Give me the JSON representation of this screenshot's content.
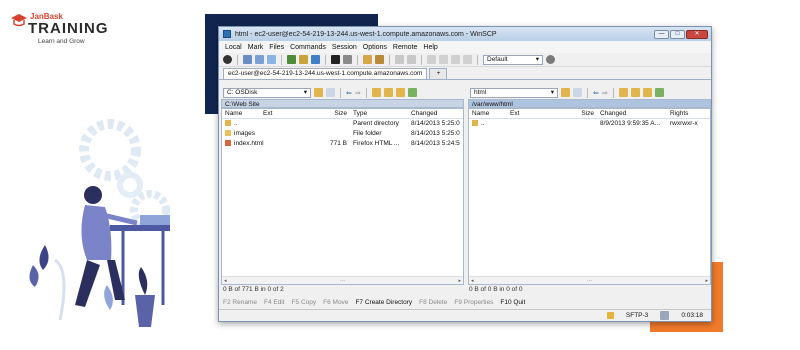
{
  "brand": {
    "name_small": "JanBask",
    "name_big": "TRAINING",
    "tagline": "Learn and Grow"
  },
  "window": {
    "title": "html - ec2-user@ec2-54-219-13-244.us-west-1.compute.amazonaws.com - WinSCP",
    "buttons": [
      "—",
      "□",
      "✕"
    ]
  },
  "menu": [
    "Local",
    "Mark",
    "Files",
    "Commands",
    "Session",
    "Options",
    "Remote",
    "Help"
  ],
  "toolbar": {
    "transfer_setting": "Default"
  },
  "tabs": [
    {
      "label": "ec2-user@ec2-54-219-13-244.us-west-1.compute.amazonaws.com"
    },
    {
      "label": "+"
    }
  ],
  "left_pane": {
    "drive": "C: OSDisk",
    "path": "C:\\Web Site",
    "columns": [
      "Name",
      "Ext",
      "Size",
      "Type",
      "Changed"
    ],
    "rows": [
      {
        "name": "..",
        "ext": "",
        "size": "",
        "type": "Parent directory",
        "changed": "8/14/2013 5:25:0",
        "icon": "parent-folder-icon"
      },
      {
        "name": "images",
        "ext": "",
        "size": "",
        "type": "File folder",
        "changed": "8/14/2013 5:25:0",
        "icon": "folder-icon"
      },
      {
        "name": "index.html",
        "ext": "",
        "size": "771 B",
        "type": "Firefox HTML ...",
        "changed": "8/14/2013 5:24:5",
        "icon": "html-file-icon"
      }
    ],
    "status": "0 B of 771 B in 0 of 2"
  },
  "right_pane": {
    "drive": "html",
    "path": "/var/www/html",
    "columns": [
      "Name",
      "Ext",
      "Size",
      "Changed",
      "Rights"
    ],
    "rows": [
      {
        "name": "..",
        "ext": "",
        "size": "",
        "changed": "8/9/2013 9:59:35 A...",
        "rights": "rwxrwxr-x",
        "icon": "parent-folder-icon"
      }
    ],
    "status": "0 B of 0 B in 0 of 0"
  },
  "fkeys": [
    {
      "label": "F2 Rename",
      "enabled": false
    },
    {
      "label": "F4 Edit",
      "enabled": false
    },
    {
      "label": "F5 Copy",
      "enabled": false
    },
    {
      "label": "F6 Move",
      "enabled": false
    },
    {
      "label": "F7 Create Directory",
      "enabled": true
    },
    {
      "label": "F8 Delete",
      "enabled": false
    },
    {
      "label": "F9 Properties",
      "enabled": false
    },
    {
      "label": "F10 Quit",
      "enabled": true
    }
  ],
  "statusbar": {
    "protocol": "SFTP-3",
    "elapsed": "0:03:18"
  },
  "colors": {
    "navy": "#11254f",
    "orange": "#f07b2b",
    "brand_red": "#d8432f"
  }
}
